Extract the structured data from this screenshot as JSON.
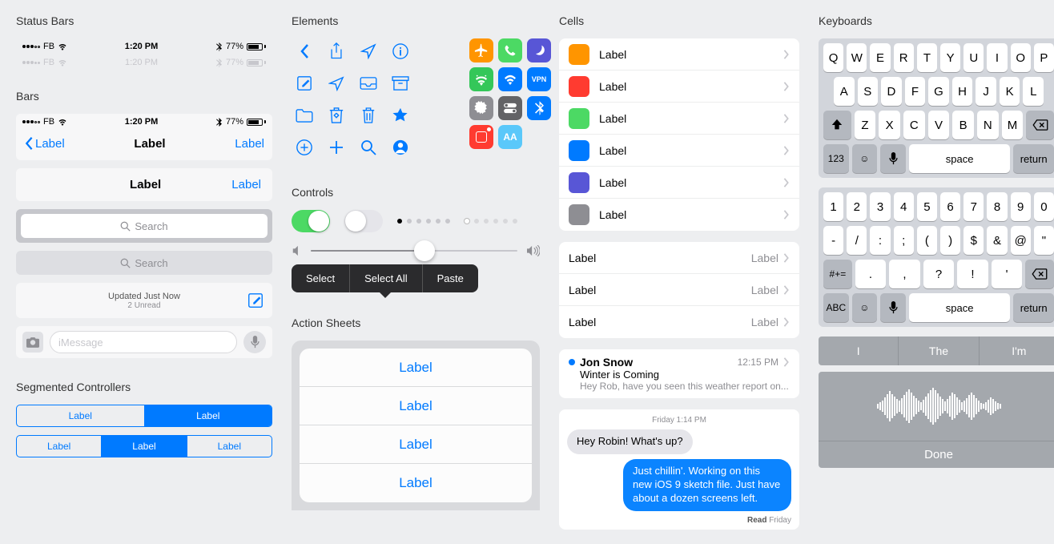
{
  "sections": {
    "status_bars": "Status Bars",
    "bars": "Bars",
    "segmented": "Segmented Controllers",
    "elements": "Elements",
    "controls": "Controls",
    "action_sheets": "Action Sheets",
    "cells": "Cells",
    "keyboards": "Keyboards"
  },
  "status": {
    "carrier": "FB",
    "time": "1:20 PM",
    "battery_pct": "77%"
  },
  "nav": {
    "back_label": "Label",
    "title": "Label",
    "right_label": "Label"
  },
  "plain_bar": {
    "center": "Label",
    "right": "Label"
  },
  "search": {
    "placeholder": "Search"
  },
  "update": {
    "line1": "Updated Just Now",
    "line2": "2 Unread"
  },
  "imessage": {
    "placeholder": "iMessage"
  },
  "segmented": {
    "row1": [
      "Label",
      "Label"
    ],
    "row2": [
      "Label",
      "Label",
      "Label"
    ]
  },
  "context_menu": [
    "Select",
    "Select All",
    "Paste"
  ],
  "action_sheet": [
    "Label",
    "Label",
    "Label",
    "Label"
  ],
  "color_cells": [
    {
      "color": "c-orange",
      "label": "Label"
    },
    {
      "color": "c-red",
      "label": "Label"
    },
    {
      "color": "c-green",
      "label": "Label"
    },
    {
      "color": "c-blue",
      "label": "Label"
    },
    {
      "color": "c-purple",
      "label": "Label"
    },
    {
      "color": "c-gray",
      "label": "Label"
    }
  ],
  "detail_cells": [
    {
      "label": "Label",
      "value": "Label"
    },
    {
      "label": "Label",
      "value": "Label"
    },
    {
      "label": "Label",
      "value": "Label"
    }
  ],
  "mail": {
    "sender": "Jon Snow",
    "time": "12:15 PM",
    "subject": "Winter is Coming",
    "preview": "Hey Rob, have you seen this weather report on..."
  },
  "chat": {
    "date": "Friday 1:14 PM",
    "msg_in": "Hey Robin! What's up?",
    "msg_out": "Just chillin'. Working on this new iOS 9 sketch file. Just have about a dozen screens left.",
    "read_label": "Read",
    "read_time": "Friday"
  },
  "keyboard_alpha": {
    "r1": [
      "Q",
      "W",
      "E",
      "R",
      "T",
      "Y",
      "U",
      "I",
      "O",
      "P"
    ],
    "r2": [
      "A",
      "S",
      "D",
      "F",
      "G",
      "H",
      "J",
      "K",
      "L"
    ],
    "r3": [
      "Z",
      "X",
      "C",
      "V",
      "B",
      "N",
      "M"
    ],
    "num_key": "123",
    "space": "space",
    "return": "return"
  },
  "keyboard_num": {
    "r1": [
      "1",
      "2",
      "3",
      "4",
      "5",
      "6",
      "7",
      "8",
      "9",
      "0"
    ],
    "r2": [
      "-",
      "/",
      ":",
      ";",
      "(",
      ")",
      "$",
      "&",
      "@",
      "\""
    ],
    "r3": [
      ".",
      ",",
      "?",
      "!",
      "'"
    ],
    "sym_key": "#+=",
    "abc_key": "ABC",
    "space": "space",
    "return": "return"
  },
  "suggestions": [
    "I",
    "The",
    "I'm"
  ],
  "done": "Done",
  "app_icons": {
    "vpn": "VPN",
    "aa": "AA"
  }
}
